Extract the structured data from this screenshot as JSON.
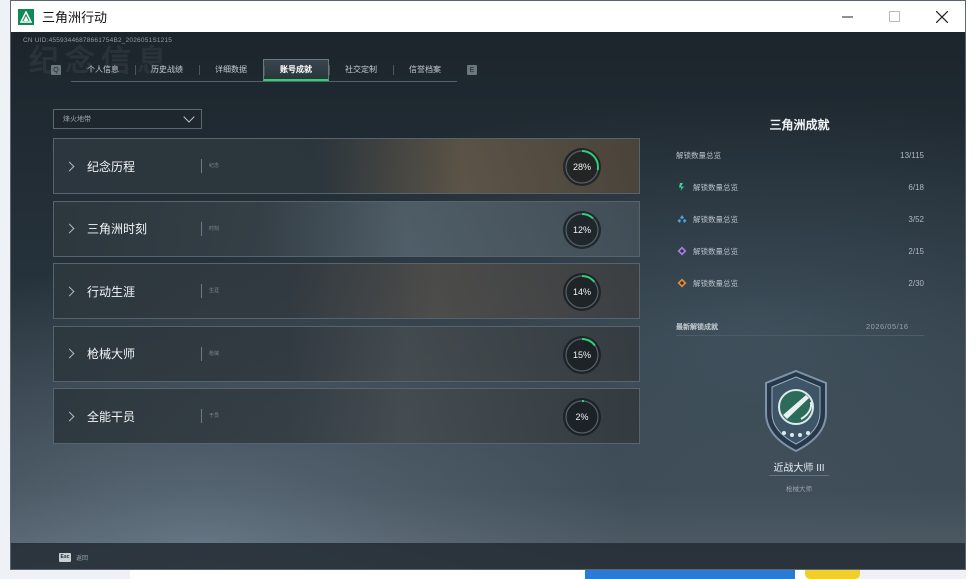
{
  "window": {
    "title": "三角洲行动",
    "controls": {
      "minimize": "—",
      "maximize": "☐",
      "close": "✕"
    }
  },
  "header": {
    "uid": "CN UID:45593446878661754B2_2026051S1215",
    "watermark": "纪念信息"
  },
  "nav": {
    "prev": "Q",
    "next": "E",
    "tabs": [
      {
        "label": "个人信息",
        "active": false
      },
      {
        "label": "历史战绩",
        "active": false
      },
      {
        "label": "详细数据",
        "active": false
      },
      {
        "label": "账号成就",
        "active": true
      },
      {
        "label": "社交定制",
        "active": false
      },
      {
        "label": "信誉档案",
        "active": false
      }
    ]
  },
  "filter": {
    "value": "烽火地带"
  },
  "achievements": [
    {
      "name": "纪念历程",
      "tag": "纪念",
      "percent": 28,
      "percent_label": "28%"
    },
    {
      "name": "三角洲时刻",
      "tag": "时刻",
      "percent": 12,
      "percent_label": "12%"
    },
    {
      "name": "行动生涯",
      "tag": "生涯",
      "percent": 14,
      "percent_label": "14%"
    },
    {
      "name": "枪械大师",
      "tag": "枪械",
      "percent": 15,
      "percent_label": "15%"
    },
    {
      "name": "全能干员",
      "tag": "干员",
      "percent": 2,
      "percent_label": "2%"
    }
  ],
  "panel": {
    "title": "三角洲成就",
    "overall": {
      "label": "解锁数量总览",
      "value": "13/115"
    },
    "tiers": [
      {
        "icon": "green-tier-icon",
        "color": "#3fd49a",
        "label": "解锁数量总览",
        "value": "6/18"
      },
      {
        "icon": "blue-tier-icon",
        "color": "#4aa6e8",
        "label": "解锁数量总览",
        "value": "3/52"
      },
      {
        "icon": "purple-tier-icon",
        "color": "#a77be0",
        "label": "解锁数量总览",
        "value": "2/15"
      },
      {
        "icon": "orange-tier-icon",
        "color": "#e08a3a",
        "label": "解锁数量总览",
        "value": "2/30"
      }
    ],
    "latest": {
      "label": "最新解锁成就",
      "date": "2026/05/16"
    },
    "badge": {
      "name": "近战大师 III",
      "category": "枪械大师"
    }
  },
  "footer": {
    "key": "Esc",
    "label": "返回"
  },
  "colors": {
    "accent": "#2fd07a",
    "progress": "#2fd07a"
  }
}
